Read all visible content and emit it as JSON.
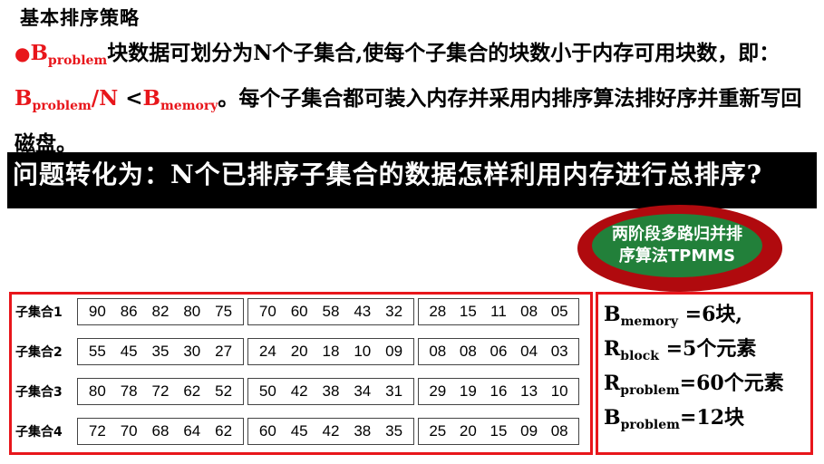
{
  "heading": "基本排序策略",
  "para": {
    "bullet": "●",
    "b1_base": "B",
    "b1_sub": "problem",
    "text1": "块数据可划分为N个子集合,使每个子集合的块数小于内存可用块数，即：",
    "b2_base": "B",
    "b2_sub": "problem",
    "slash_n": "/N",
    "lt": " <",
    "b3_base": "B",
    "b3_sub": "memory",
    "text2": "。每个子集合都可装入内存并采用内排序算法排好序并重新写回磁盘。"
  },
  "banner": "问题转化为：N个已排序子集合的数据怎样利用内存进行总排序?",
  "oval": {
    "line1": "两阶段多路归并排",
    "line2": "序算法TPMMS"
  },
  "rows": [
    {
      "label": "子集合1",
      "groups": [
        [
          "90",
          "86",
          "82",
          "80",
          "75"
        ],
        [
          "70",
          "60",
          "58",
          "43",
          "32"
        ],
        [
          "28",
          "15",
          "11",
          "08",
          "05"
        ]
      ]
    },
    {
      "label": "子集合2",
      "groups": [
        [
          "55",
          "45",
          "35",
          "30",
          "27"
        ],
        [
          "24",
          "20",
          "18",
          "10",
          "09"
        ],
        [
          "08",
          "08",
          "06",
          "04",
          "03"
        ]
      ]
    },
    {
      "label": "子集合3",
      "groups": [
        [
          "80",
          "78",
          "72",
          "62",
          "52"
        ],
        [
          "50",
          "42",
          "38",
          "34",
          "31"
        ],
        [
          "29",
          "19",
          "16",
          "13",
          "10"
        ]
      ]
    },
    {
      "label": "子集合4",
      "groups": [
        [
          "72",
          "70",
          "68",
          "64",
          "62"
        ],
        [
          "60",
          "45",
          "42",
          "38",
          "35"
        ],
        [
          "25",
          "20",
          "15",
          "09",
          "08"
        ]
      ]
    }
  ],
  "params": [
    {
      "base": "B",
      "sub": "memory",
      "value": " =6块,"
    },
    {
      "base": "R",
      "sub": "block",
      "value": " =5个元素"
    },
    {
      "base": "R",
      "sub": "problem",
      "value": "=60个元素"
    },
    {
      "base": "B",
      "sub": "problem",
      "value": "=12块"
    }
  ]
}
